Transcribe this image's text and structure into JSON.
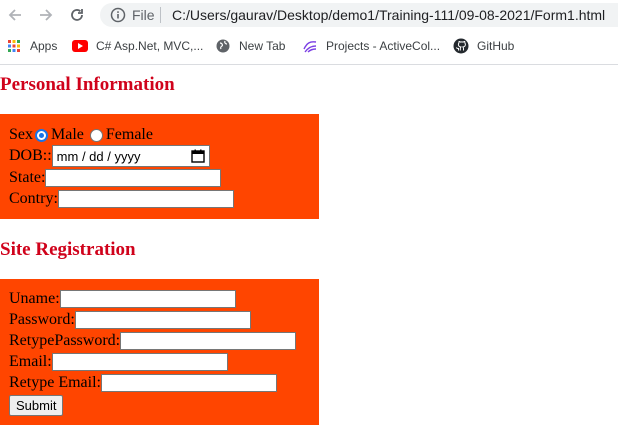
{
  "browser": {
    "back_icon": "arrow-left-icon",
    "forward_icon": "arrow-right-icon",
    "reload_icon": "reload-icon",
    "address": {
      "scheme_label": "File",
      "url": "C:/Users/gaurav/Desktop/demo1/Training-111/09-08-2021/Form1.html"
    },
    "bookmarks": [
      {
        "label": "Apps",
        "icon": "apps-grid-icon"
      },
      {
        "label": "C# Asp.Net, MVC,...",
        "icon": "youtube-icon"
      },
      {
        "label": "New Tab",
        "icon": "globe-icon"
      },
      {
        "label": "Projects - ActiveCol...",
        "icon": "activecollab-icon"
      },
      {
        "label": "GitHub",
        "icon": "github-icon"
      }
    ]
  },
  "colors": {
    "panel": "#ff4500",
    "heading": "#d0021b"
  },
  "personal": {
    "title": "Personal Information",
    "sex_label": "Sex",
    "male_label": "Male",
    "female_label": "Female",
    "selected_sex": "Male",
    "dob_label": "DOB::",
    "dob_placeholder": "mm / dd / yyyy",
    "state_label": "State:",
    "country_label": "Contry:"
  },
  "registration": {
    "title": "Site Registration",
    "uname_label": "Uname:",
    "password_label": "Password:",
    "retype_password_label": "RetypePassword:",
    "email_label": "Email:",
    "retype_email_label": "Retype Email:",
    "submit_label": "Submit"
  }
}
